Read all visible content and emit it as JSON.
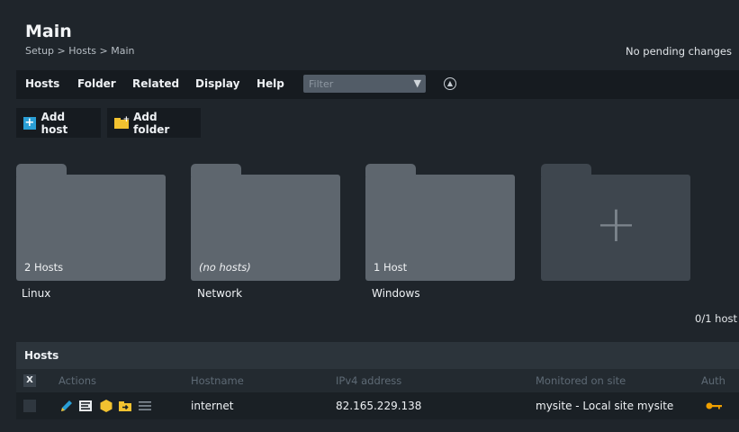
{
  "page": {
    "title": "Main",
    "breadcrumb": "Setup > Hosts > Main",
    "pending": "No pending changes"
  },
  "menu": {
    "items": [
      "Hosts",
      "Folder",
      "Related",
      "Display",
      "Help"
    ],
    "filter_placeholder": "Filter"
  },
  "buttons": {
    "add_host": "Add host",
    "add_folder": "Add folder"
  },
  "folders": [
    {
      "name": "Linux",
      "count": "2 Hosts"
    },
    {
      "name": "Network",
      "count": "(no hosts)"
    },
    {
      "name": "Windows",
      "count": "1 Host"
    }
  ],
  "host_count": "0/1 host",
  "table": {
    "title": "Hosts",
    "select_all": "X",
    "columns": [
      "Actions",
      "Hostname",
      "IPv4 address",
      "Monitored on site",
      "Auth"
    ],
    "rows": [
      {
        "hostname": "internet",
        "ipv4": "82.165.229.138",
        "site": "mysite - Local site mysite"
      }
    ]
  },
  "icons": {
    "edit": "edit-icon",
    "properties": "properties-icon",
    "rules": "rules-icon",
    "move": "move-folder-icon",
    "menu": "menu-icon",
    "auth": "key-icon"
  },
  "colors": {
    "accent_blue": "#2a9fd6",
    "folder_yellow": "#f2c230",
    "key_orange": "#f0a000"
  }
}
